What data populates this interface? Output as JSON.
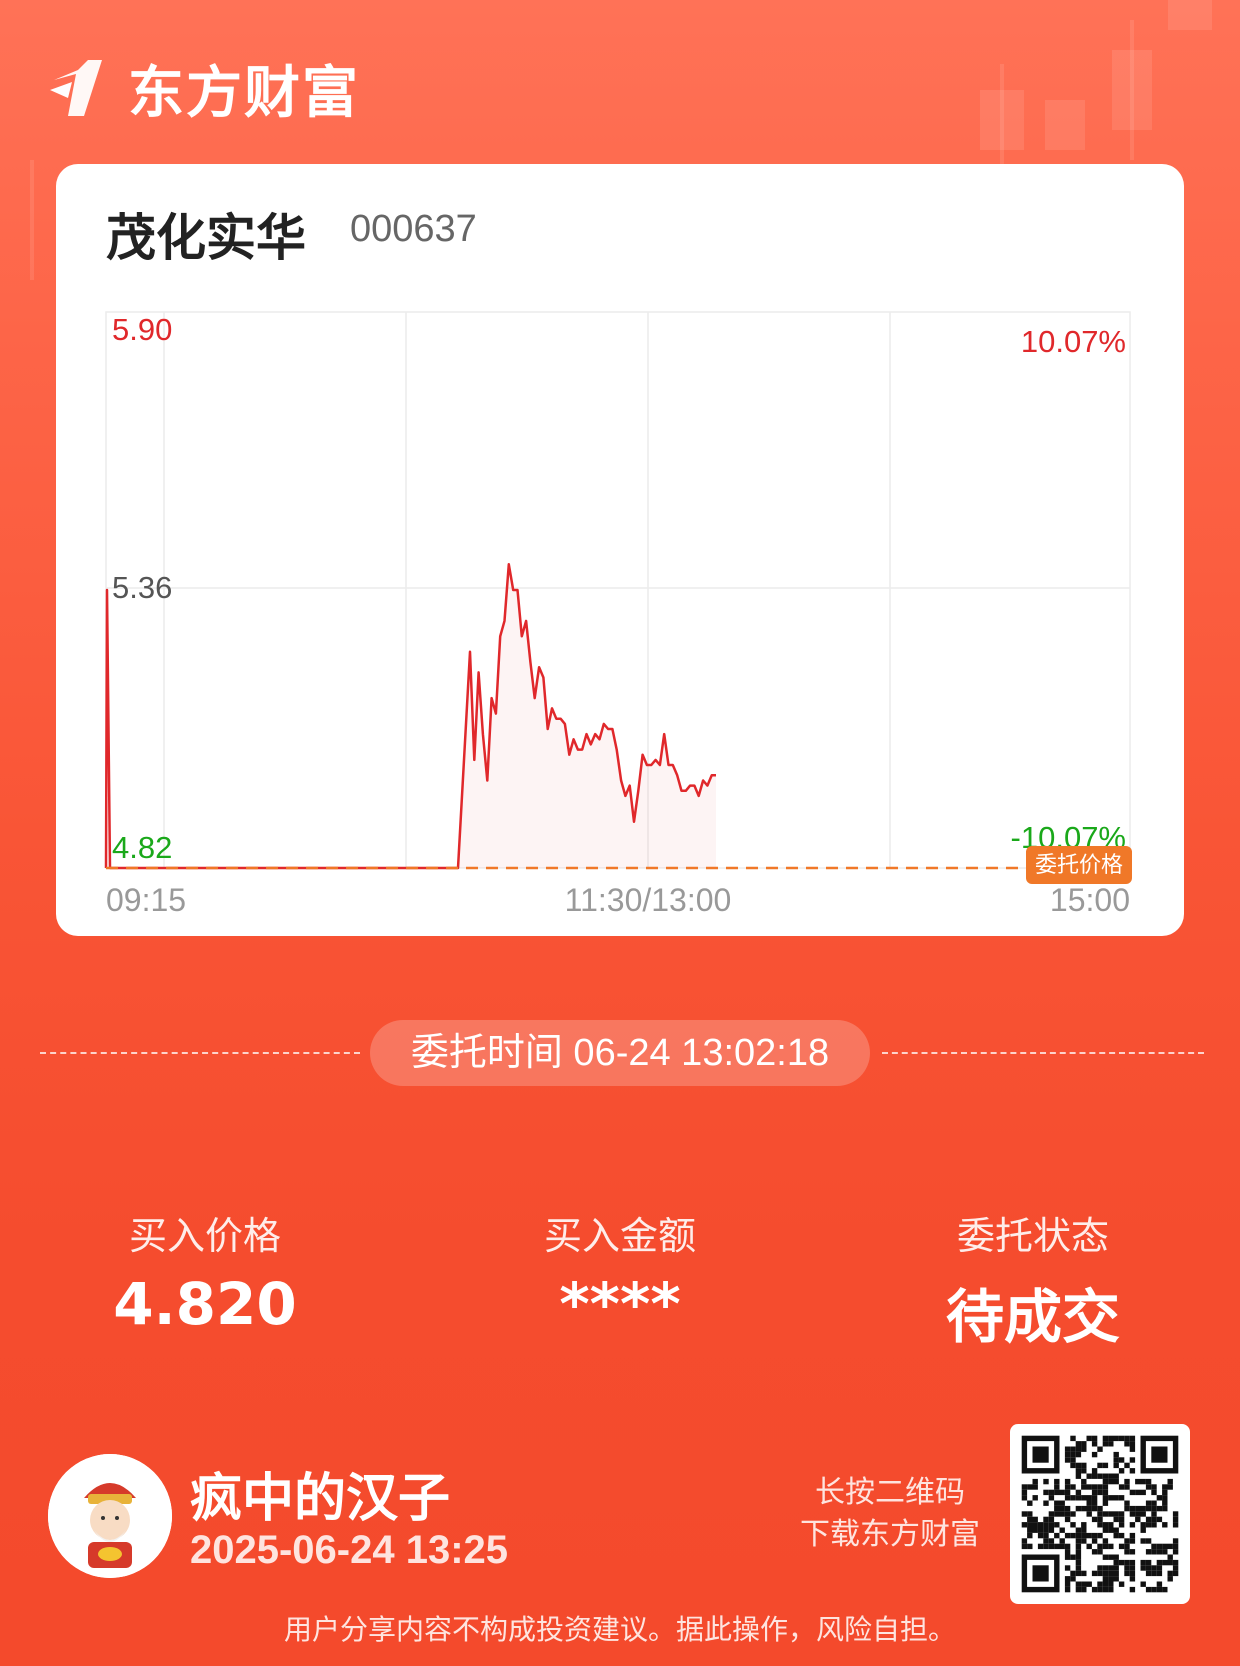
{
  "brand": {
    "name": "东方财富"
  },
  "stock": {
    "name": "茂化实华",
    "code": "000637"
  },
  "chart_data": {
    "type": "line",
    "y_labels": {
      "top": "5.90",
      "mid": "5.36",
      "bottom": "4.82"
    },
    "pct_labels": {
      "top": "10.07%",
      "bottom": "-10.07%"
    },
    "x_labels": [
      "09:15",
      "11:30/13:00",
      "15:00"
    ],
    "ylim": [
      4.82,
      5.9
    ],
    "order_price": 4.82,
    "order_price_label": "委托价格",
    "series": [
      {
        "values": [
          4.82,
          5.36,
          4.82,
          4.82,
          4.82,
          4.82,
          4.82,
          5.24,
          5.03,
          5.2,
          5.08,
          4.99,
          5.15,
          5.12,
          5.27,
          5.3,
          5.41,
          5.36,
          5.36,
          5.27,
          5.3,
          5.22,
          5.15,
          5.21,
          5.19,
          5.09,
          5.13,
          5.11,
          5.11,
          5.1,
          5.04,
          5.07,
          5.05,
          5.05,
          5.08,
          5.06,
          5.08,
          5.07,
          5.1,
          5.09,
          5.09,
          5.05,
          4.99,
          4.96,
          4.98,
          4.91,
          4.97,
          5.04,
          5.02,
          5.02,
          5.03,
          5.02,
          5.08,
          5.02,
          5.02,
          5.0,
          4.97,
          4.97,
          4.98,
          4.98,
          4.96,
          4.99,
          4.98,
          5.0,
          5.0
        ]
      }
    ]
  },
  "order": {
    "time_label": "委托时间 06-24 13:02:18"
  },
  "stats": [
    {
      "label": "买入价格",
      "value": "4.820"
    },
    {
      "label": "买入金额",
      "value": "****"
    },
    {
      "label": "委托状态",
      "value": "待成交"
    }
  ],
  "user": {
    "name": "疯中的汉子",
    "datetime": "2025-06-24 13:25"
  },
  "qr": {
    "hint_line1": "长按二维码",
    "hint_line2": "下载东方财富"
  },
  "disclaimer": "用户分享内容不构成投资建议。据此操作，风险自担。"
}
